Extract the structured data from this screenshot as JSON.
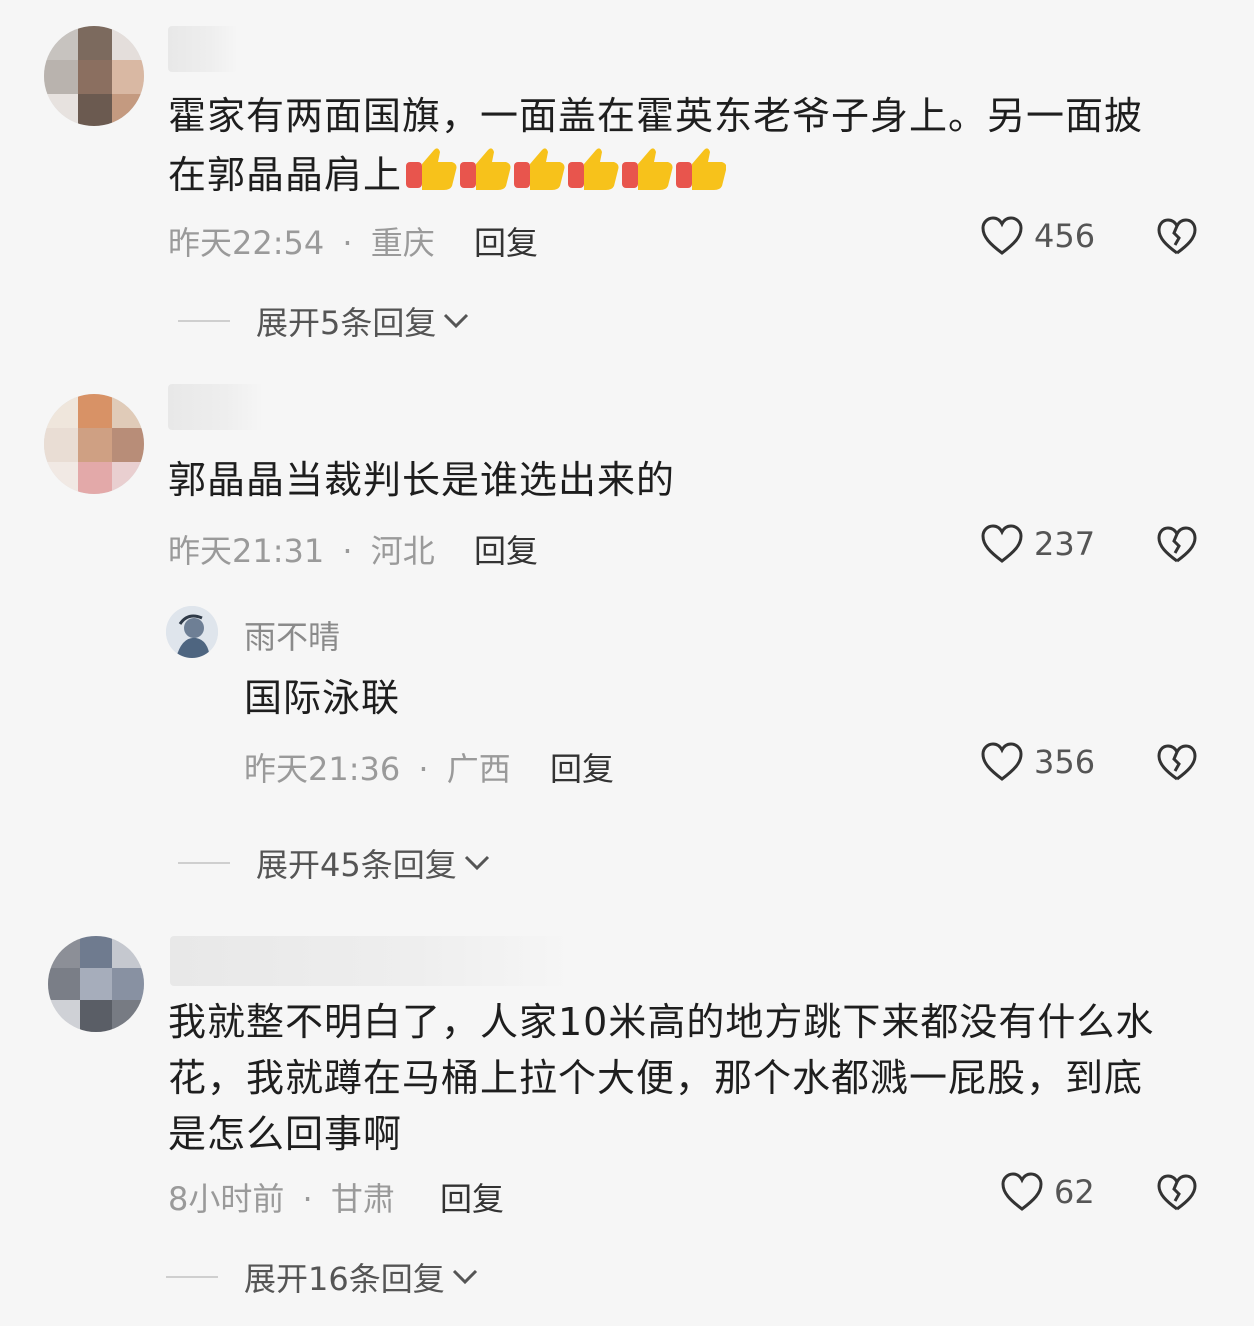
{
  "comments": [
    {
      "text_line1": "霍家有两面国旗，一面盖在霍英东老爷子身上。另一面披",
      "text_line2": "在郭晶晶肩上",
      "emoji": "thumbs-up-icon x6",
      "time": "昨天22:54",
      "sep": "·",
      "location": "重庆",
      "reply_label": "回复",
      "likes": "456",
      "expand_label": "展开5条回复"
    },
    {
      "text_line1": "郭晶晶当裁判长是谁选出来的",
      "time": "昨天21:31",
      "sep": "·",
      "location": "河北",
      "reply_label": "回复",
      "likes": "237",
      "sub_reply": {
        "name": "雨不晴",
        "text": "国际泳联",
        "time": "昨天21:36",
        "sep": "·",
        "location": "广西",
        "reply_label": "回复",
        "likes": "356"
      },
      "expand_label": "展开45条回复"
    },
    {
      "text_line1": "我就整不明白了，人家10米高的地方跳下来都没有什么水",
      "text_line2": "花，我就蹲在马桶上拉个大便，那个水都溅一屁股，到底",
      "text_line3": "是怎么回事啊",
      "time": "8小时前",
      "sep": "·",
      "location": "甘肃",
      "reply_label": "回复",
      "likes": "62",
      "expand_label": "展开16条回复"
    }
  ],
  "colors": {
    "background": "#f6f6f6",
    "text": "#1e1e1e",
    "meta": "#9a9a9a",
    "thumb": "#f5b800",
    "cuff": "#e8554d"
  }
}
